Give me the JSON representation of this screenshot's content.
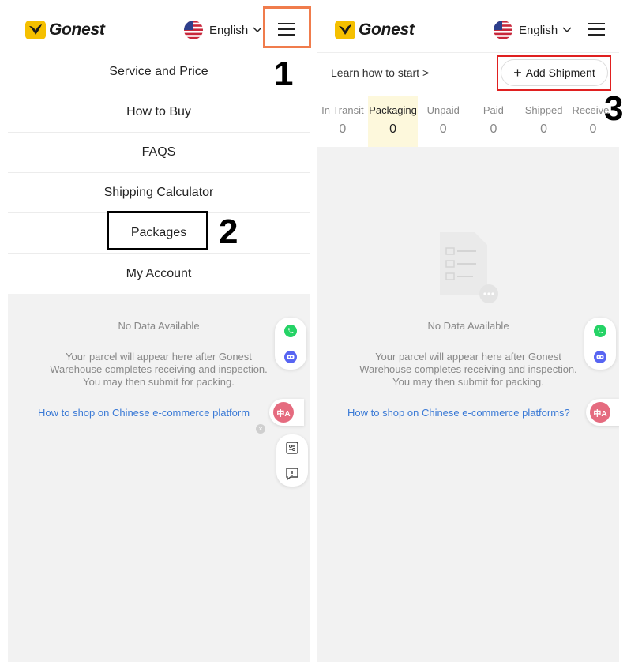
{
  "header": {
    "logo_text": "Gonest",
    "language_label": "English",
    "flag_icon": "us-flag-icon",
    "menu_icon": "hamburger-menu-icon"
  },
  "left_panel": {
    "menu_items": [
      {
        "label": "Service and Price"
      },
      {
        "label": "How to Buy"
      },
      {
        "label": "FAQS"
      },
      {
        "label": "Shipping Calculator"
      },
      {
        "label": "Packages"
      },
      {
        "label": "My Account"
      }
    ],
    "empty_title": "No Data Available",
    "empty_desc_lines": [
      "Your parcel will appear here after Gonest",
      "Warehouse completes receiving and inspection.",
      "You may then submit for packing."
    ],
    "shop_link": "How to shop on Chinese e-commerce platform"
  },
  "right_panel": {
    "learn_link": "Learn how to start >",
    "add_shipment_label": "Add Shipment",
    "tabs": [
      {
        "label": "In Transit",
        "count": "0"
      },
      {
        "label": "Packaging",
        "count": "0"
      },
      {
        "label": "Unpaid",
        "count": "0"
      },
      {
        "label": "Paid",
        "count": "0"
      },
      {
        "label": "Shipped",
        "count": "0"
      },
      {
        "label": "Receive",
        "count": "0"
      }
    ],
    "active_tab": "Packaging",
    "empty_title": "No Data Available",
    "empty_desc_lines": [
      "Your parcel will appear here after Gonest",
      "Warehouse completes receiving and inspection.",
      "You may then submit for packing."
    ],
    "shop_link": "How to shop on Chinese e-commerce platforms?"
  },
  "annotations": {
    "step1": "1",
    "step2": "2",
    "step3": "3"
  },
  "floating": {
    "translate_label": "中A",
    "icons": [
      "whatsapp-icon",
      "discord-icon",
      "settings-icon",
      "feedback-icon"
    ]
  },
  "colors": {
    "brand_yellow": "#f5c000",
    "link_blue": "#3b7ad6",
    "active_tab_bg": "#fdf8dc",
    "callout_orange": "#f07c4c",
    "callout_red": "#e02020",
    "whatsapp_green": "#25d366",
    "discord_blue": "#5865f2",
    "translate_pink": "#e56b7f"
  }
}
